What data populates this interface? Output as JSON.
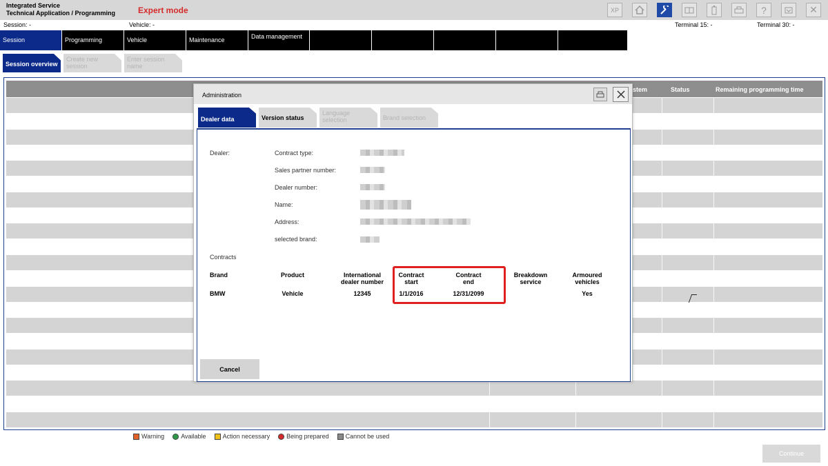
{
  "title_bar": {
    "app_line1": "Integrated Service",
    "app_line2": "Technical Application / Programming",
    "mode": "Expert mode",
    "icons": [
      "xp-icon",
      "home-icon",
      "wrench-icon",
      "keyboard-icon",
      "battery-icon",
      "printer-icon",
      "help-icon",
      "minimize-icon",
      "close-icon"
    ],
    "xp_label": "XP",
    "help_label": "?",
    "close_label": "✕"
  },
  "status_line": {
    "session": "Session:  -",
    "vehicle": "Vehicle:  -",
    "terminal15": "Terminal 15:  -",
    "terminal30": "Terminal 30:  -"
  },
  "main_nav": {
    "tabs": [
      "Session",
      "Programming",
      "Vehicle",
      "Maintenance",
      "Data management",
      "",
      "",
      "",
      "",
      ""
    ]
  },
  "sub_nav": {
    "tabs": [
      "Session overview",
      "Create new session",
      "Enter session name"
    ]
  },
  "table": {
    "headers": [
      "stem",
      "Status",
      "Remaining programming time"
    ]
  },
  "legend": {
    "items": [
      "Warning",
      "Available",
      "Action necessary",
      "Being prepared",
      "Cannot be used"
    ],
    "colors": [
      "#e2622a",
      "#2f9b4a",
      "#f2c21c",
      "#d62b2b",
      "#8a8a8a"
    ]
  },
  "continue_label": "Continue",
  "dialog": {
    "title": "Administration",
    "tabs": [
      "Dealer data",
      "Version status",
      "Language selection",
      "Brand selection"
    ],
    "dealer_label": "Dealer:",
    "fields": [
      "Contract type:",
      "Sales partner number:",
      "Dealer number:",
      "Name:",
      "Address:",
      "selected brand:"
    ],
    "contracts_label": "Contracts",
    "contract_headers": [
      "Brand",
      "Product",
      "International dealer number",
      "Contract start",
      "Contract end",
      "Breakdown service",
      "Armoured vehicles"
    ],
    "contract_row": [
      "BMW",
      "Vehicle",
      "12345",
      "1/1/2016",
      "12/31/2099",
      "",
      "Yes"
    ],
    "cancel_label": "Cancel"
  },
  "accent": "#0b2a8a",
  "highlight_color": "#e02020"
}
